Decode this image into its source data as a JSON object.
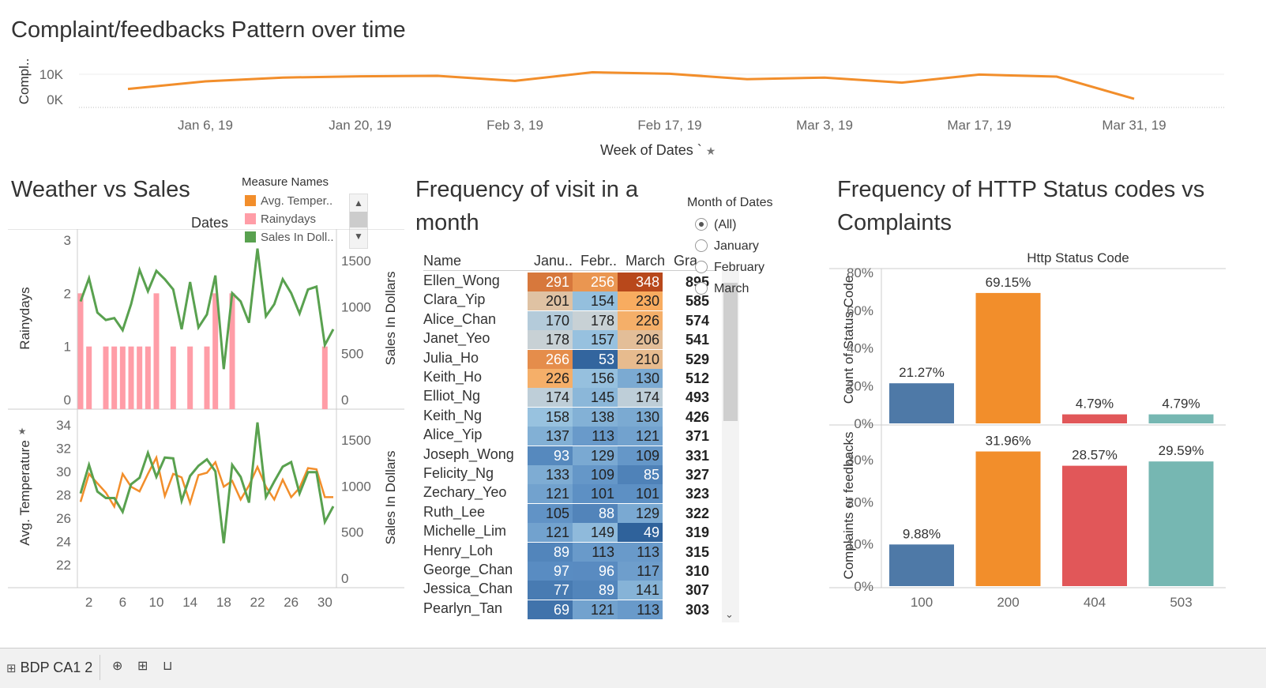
{
  "complaints": {
    "title": "Complaint/feedbacks Pattern over time",
    "y_label": "Compl..",
    "x_label": "Week of Dates",
    "x_label_suffix": "`",
    "pin_icon": "pin-icon",
    "y_ticks": [
      "10K",
      "0K"
    ],
    "x_ticks": [
      "Jan 6, 19",
      "Jan 20, 19",
      "Feb 3, 19",
      "Feb 17, 19",
      "Mar 3, 19",
      "Mar 17, 19",
      "Mar 31, 19"
    ],
    "line_color": "#f28e2b"
  },
  "weather": {
    "title": "Weather vs Sales",
    "dates_label": "Dates",
    "legend_title": "Measure Names",
    "legend": [
      {
        "label": "Avg. Temper..",
        "color": "#f28e2b"
      },
      {
        "label": "Rainydays",
        "color": "#ff9da7"
      },
      {
        "label": "Sales In Doll..",
        "color": "#59a14f"
      }
    ],
    "top_left_label": "Rainydays",
    "top_right_label": "Sales In Dollars",
    "bottom_left_label": "Avg. Temperature",
    "bottom_right_label": "Sales In Dollars",
    "top_left_ticks": [
      "3",
      "2",
      "1",
      "0"
    ],
    "right_ticks": [
      "1500",
      "1000",
      "500",
      "0"
    ],
    "bottom_left_ticks": [
      "34",
      "32",
      "30",
      "28",
      "26",
      "24",
      "22"
    ],
    "x_ticks": [
      "2",
      "6",
      "10",
      "14",
      "18",
      "22",
      "26",
      "30"
    ]
  },
  "visits": {
    "title_line1": "Frequency of visit in a",
    "title_line2": "month",
    "header_name": "Name",
    "header_jan": "Janu..",
    "header_feb": "Febr..",
    "header_mar": "March",
    "header_total": "Gra..",
    "rows": [
      {
        "name": "Ellen_Wong",
        "jan": "291",
        "feb": "256",
        "mar": "348",
        "total": "895"
      },
      {
        "name": "Clara_Yip",
        "jan": "201",
        "feb": "154",
        "mar": "230",
        "total": "585"
      },
      {
        "name": "Alice_Chan",
        "jan": "170",
        "feb": "178",
        "mar": "226",
        "total": "574"
      },
      {
        "name": "Janet_Yeo",
        "jan": "178",
        "feb": "157",
        "mar": "206",
        "total": "541"
      },
      {
        "name": "Julia_Ho",
        "jan": "266",
        "feb": "53",
        "mar": "210",
        "total": "529"
      },
      {
        "name": "Keith_Ho",
        "jan": "226",
        "feb": "156",
        "mar": "130",
        "total": "512"
      },
      {
        "name": "Elliot_Ng",
        "jan": "174",
        "feb": "145",
        "mar": "174",
        "total": "493"
      },
      {
        "name": "Keith_Ng",
        "jan": "158",
        "feb": "138",
        "mar": "130",
        "total": "426"
      },
      {
        "name": "Alice_Yip",
        "jan": "137",
        "feb": "113",
        "mar": "121",
        "total": "371"
      },
      {
        "name": "Joseph_Wong",
        "jan": "93",
        "feb": "129",
        "mar": "109",
        "total": "331"
      },
      {
        "name": "Felicity_Ng",
        "jan": "133",
        "feb": "109",
        "mar": "85",
        "total": "327"
      },
      {
        "name": "Zechary_Yeo",
        "jan": "121",
        "feb": "101",
        "mar": "101",
        "total": "323"
      },
      {
        "name": "Ruth_Lee",
        "jan": "105",
        "feb": "88",
        "mar": "129",
        "total": "322"
      },
      {
        "name": "Michelle_Lim",
        "jan": "121",
        "feb": "149",
        "mar": "49",
        "total": "319"
      },
      {
        "name": "Henry_Loh",
        "jan": "89",
        "feb": "113",
        "mar": "113",
        "total": "315"
      },
      {
        "name": "George_Chan",
        "jan": "97",
        "feb": "96",
        "mar": "117",
        "total": "310"
      },
      {
        "name": "Jessica_Chan",
        "jan": "77",
        "feb": "89",
        "mar": "141",
        "total": "307"
      },
      {
        "name": "Pearlyn_Tan",
        "jan": "69",
        "feb": "121",
        "mar": "113",
        "total": "303"
      }
    ]
  },
  "month_filter": {
    "title": "Month of Dates",
    "options": [
      "(All)",
      "January",
      "February",
      "March"
    ],
    "selected": "(All)"
  },
  "http": {
    "title_line1": "Frequency of HTTP Status codes vs",
    "title_line2": "Complaints",
    "header": "Http Status Code",
    "top_y_label": "Count of Status Code",
    "bottom_y_label": "Complaints or feedbacks",
    "top_ticks": [
      "80%",
      "60%",
      "40%",
      "20%",
      "0%"
    ],
    "bottom_ticks": [
      "30%",
      "20%",
      "10%",
      "0%"
    ]
  },
  "tabs": {
    "workbook": "BDP CA1 2",
    "workbook_icon": "grid-icon",
    "new_sheet_icon": "new-worksheet-icon",
    "new_dashboard_icon": "new-dashboard-icon",
    "new_story_icon": "new-story-icon"
  },
  "chart_data": [
    {
      "type": "line",
      "title": "Complaint/feedbacks Pattern over time",
      "xlabel": "Week of Dates",
      "ylabel": "Compl..",
      "x": [
        "Dec 30, 18",
        "Jan 6, 19",
        "Jan 13, 19",
        "Jan 20, 19",
        "Jan 27, 19",
        "Feb 3, 19",
        "Feb 10, 19",
        "Feb 17, 19",
        "Feb 24, 19",
        "Mar 3, 19",
        "Mar 10, 19",
        "Mar 17, 19",
        "Mar 24, 19",
        "Mar 31, 19"
      ],
      "values": [
        7300,
        10300,
        11800,
        12300,
        12500,
        10500,
        13900,
        13300,
        11200,
        11800,
        9800,
        13000,
        12200,
        3400
      ],
      "ylim": [
        0,
        15000
      ],
      "series": [
        {
          "name": "",
          "color": "#f28e2b"
        }
      ]
    },
    {
      "type": "bar",
      "title": "Weather vs Sales",
      "xlabel": "Dates",
      "ylabel": "Rainydays",
      "x": [
        1,
        2,
        3,
        4,
        5,
        6,
        7,
        8,
        9,
        10,
        11,
        12,
        13,
        14,
        15,
        16,
        17,
        18,
        19,
        20,
        21,
        22,
        23,
        24,
        25,
        26,
        27,
        28,
        29,
        30,
        31
      ],
      "series": [
        {
          "name": "Rainydays",
          "axis": "left",
          "values": [
            2,
            1,
            0,
            1,
            1,
            1,
            1,
            1,
            1,
            2,
            0,
            1,
            0,
            1,
            0,
            1,
            2,
            0,
            2,
            0,
            0,
            0,
            0,
            0,
            0,
            0,
            0,
            0,
            0,
            1,
            0
          ]
        },
        {
          "name": "Sales In Doll..",
          "axis": "right",
          "type": "line",
          "values": [
            1060,
            1310,
            940,
            860,
            880,
            750,
            1030,
            1400,
            1170,
            1390,
            1300,
            1190,
            760,
            1270,
            780,
            920,
            1340,
            330,
            1150,
            1060,
            830,
            1630,
            900,
            1030,
            1300,
            1150,
            930,
            1190,
            1220,
            590,
            760
          ]
        }
      ],
      "ylim": [
        0,
        3.2
      ],
      "y2lim": [
        0,
        1700
      ]
    },
    {
      "type": "line",
      "xlabel": "Dates",
      "ylabel": "Avg. Temperature",
      "x": [
        1,
        2,
        3,
        4,
        5,
        6,
        7,
        8,
        9,
        10,
        11,
        12,
        13,
        14,
        15,
        16,
        17,
        18,
        19,
        20,
        21,
        22,
        23,
        24,
        25,
        26,
        27,
        28,
        29,
        30,
        31
      ],
      "series": [
        {
          "name": "Avg. Temper..",
          "axis": "left",
          "values": [
            27.4,
            29.8,
            29.0,
            28.2,
            27.0,
            29.8,
            28.7,
            28.3,
            29.8,
            31.2,
            27.9,
            29.8,
            29.5,
            27.3,
            29.7,
            29.9,
            30.8,
            28.7,
            29.2,
            27.6,
            28.8,
            30.4,
            28.7,
            27.6,
            29.3,
            27.8,
            28.6,
            30.3,
            30.2,
            27.8,
            27.8
          ]
        },
        {
          "name": "Sales In Doll..",
          "axis": "right",
          "type": "line",
          "values": [
            920,
            1230,
            940,
            870,
            870,
            720,
            1020,
            1090,
            1360,
            1100,
            1310,
            1300,
            840,
            1110,
            1220,
            1290,
            1160,
            380,
            1230,
            1100,
            820,
            1690,
            880,
            1050,
            1210,
            1260,
            920,
            1150,
            1150,
            610,
            780
          ]
        }
      ],
      "ylim": [
        21,
        35
      ],
      "y2lim": [
        0,
        1700
      ]
    },
    {
      "type": "heatmap",
      "title": "Frequency of visit in a month",
      "columns": [
        "Janu..",
        "Febr..",
        "March",
        "Gra.."
      ],
      "rows": [
        "Ellen_Wong",
        "Clara_Yip",
        "Alice_Chan",
        "Janet_Yeo",
        "Julia_Ho",
        "Keith_Ho",
        "Elliot_Ng",
        "Keith_Ng",
        "Alice_Yip",
        "Joseph_Wong",
        "Felicity_Ng",
        "Zechary_Yeo",
        "Ruth_Lee",
        "Michelle_Lim",
        "Henry_Loh",
        "George_Chan",
        "Jessica_Chan",
        "Pearlyn_Tan"
      ]
    },
    {
      "type": "bar",
      "title": "Frequency of HTTP Status codes vs Complaints",
      "xlabel": "Http Status Code",
      "categories": [
        "100",
        "200",
        "404",
        "503"
      ],
      "series": [
        {
          "name": "Count of Status Code",
          "values": [
            21.27,
            69.15,
            4.79,
            4.79
          ],
          "labels": [
            "21.27%",
            "69.15%",
            "4.79%",
            "4.79%"
          ]
        },
        {
          "name": "Complaints or feedbacks",
          "values": [
            9.88,
            31.96,
            28.57,
            29.59
          ],
          "labels": [
            "9.88%",
            "31.96%",
            "28.57%",
            "29.59%"
          ]
        }
      ],
      "colors": [
        "#4e79a7",
        "#f28e2b",
        "#e15759",
        "#76b7b2"
      ],
      "ylim_top": [
        0,
        84
      ],
      "ylim_bottom": [
        0,
        36
      ]
    }
  ]
}
